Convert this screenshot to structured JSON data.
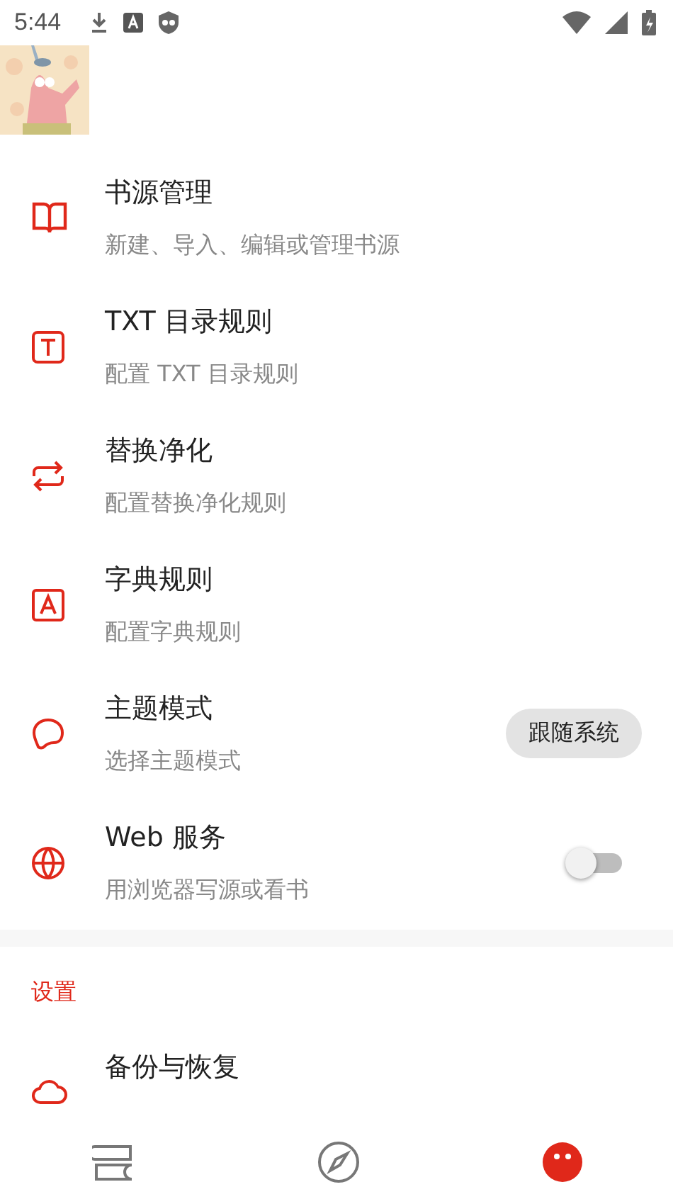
{
  "status_bar": {
    "time": "5:44"
  },
  "items": [
    {
      "kind": "plain",
      "title": "书源管理",
      "subtitle": "新建、导入、编辑或管理书源"
    },
    {
      "kind": "plain",
      "title": "TXT 目录规则",
      "subtitle": "配置 TXT 目录规则"
    },
    {
      "kind": "plain",
      "title": "替换净化",
      "subtitle": "配置替换净化规则"
    },
    {
      "kind": "plain",
      "title": "字典规则",
      "subtitle": "配置字典规则"
    },
    {
      "kind": "chip",
      "title": "主题模式",
      "subtitle": "选择主题模式",
      "value": "跟随系统"
    },
    {
      "kind": "switch",
      "title": "Web 服务",
      "subtitle": "用浏览器写源或看书",
      "on": false
    }
  ],
  "section": {
    "title": "设置",
    "items": [
      {
        "title": "备份与恢复"
      }
    ]
  },
  "bottom_nav": [
    {
      "selected": false
    },
    {
      "selected": false
    },
    {
      "selected": true
    }
  ]
}
